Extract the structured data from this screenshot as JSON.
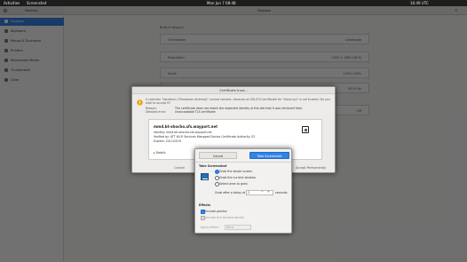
{
  "topbar": {
    "activities": "Activities",
    "app": "Screenshot",
    "clock": "Mon Jun 7  08:48",
    "status": "16:49 UTC"
  },
  "window": {
    "sidebar_title": "Devices",
    "panel_title": "Displays"
  },
  "sidebar": {
    "items": [
      {
        "label": "Displays",
        "active": true
      },
      {
        "label": "Keyboard",
        "active": false
      },
      {
        "label": "Mouse & Touchpad",
        "active": false
      },
      {
        "label": "Printers",
        "active": false
      },
      {
        "label": "Removable Media",
        "active": false
      },
      {
        "label": "Thunderbolt",
        "active": false
      },
      {
        "label": "Color",
        "active": false
      }
    ]
  },
  "display": {
    "section": "Built-in display",
    "rows": [
      {
        "key": "Orientation",
        "value": "Landscape"
      },
      {
        "key": "Resolution",
        "value": "1920 × 1080 (16:9)"
      },
      {
        "key": "Scale",
        "value": "100%    200%"
      },
      {
        "key": "",
        "value": "59.93 Hz"
      },
      {
        "key": "",
        "value": "Off"
      }
    ]
  },
  "cert": {
    "title": "Certificate trust...",
    "message": "A calendar \"Vacations (Theodorou Andreas)\" cannot connect, because an SSL/TLS certificate for \"cloud.xyz\" is not trusted. Do you wish to accept it?",
    "issuer_key": "Reason:",
    "issuer_value": "The certificate does not match the expected identity of the site that it was retrieved from.",
    "error_key": "Detailed error:",
    "error_value": "Unacceptable TLS certificate",
    "host": "mmd.bt-shocho.sfs.wayport.net",
    "identity": "Identity: mmd.btl-shocho.sfs.wayport.net",
    "verified": "Verified by: ATT Wi-Fi Services Managed Device Certificate Authority G3",
    "expires": "Expires: 2011/2019",
    "details": "▸ Details",
    "cancel": "Cancel",
    "accept": "Accept Permanently"
  },
  "screenshot": {
    "cancel": "Cancel",
    "take": "Take Screenshot",
    "section_take": "Take Screenshot",
    "options": [
      {
        "label": "Grab the whole screen",
        "selected": true
      },
      {
        "label": "Grab the current window",
        "selected": false
      },
      {
        "label": "Select area to grab",
        "selected": false
      }
    ],
    "delay_label": "Grab after a delay of",
    "delay_value": "2",
    "delay_unit": "seconds",
    "section_effects": "Effects",
    "include_pointer": "Include pointer",
    "include_border": "Include the window border",
    "apply_effect_label": "Apply effect:",
    "apply_effect_value": "None",
    "accent": "#3584e4"
  }
}
